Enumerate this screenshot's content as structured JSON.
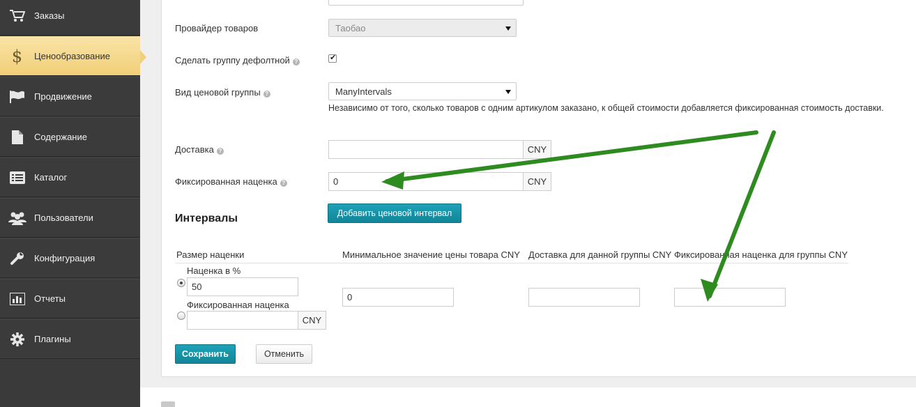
{
  "sidebar": {
    "items": [
      {
        "label": "Заказы",
        "icon": "cart-icon",
        "active": false
      },
      {
        "label": "Ценообразование",
        "icon": "dollar-icon",
        "active": true
      },
      {
        "label": "Продвижение",
        "icon": "flag-icon",
        "active": false
      },
      {
        "label": "Содержание",
        "icon": "document-icon",
        "active": false
      },
      {
        "label": "Каталог",
        "icon": "list-icon",
        "active": false
      },
      {
        "label": "Пользователи",
        "icon": "users-icon",
        "active": false
      },
      {
        "label": "Конфигурация",
        "icon": "wrench-icon",
        "active": false
      },
      {
        "label": "Отчеты",
        "icon": "chart-icon",
        "active": false
      },
      {
        "label": "Плагины",
        "icon": "gear-icon",
        "active": false
      }
    ]
  },
  "form": {
    "provider": {
      "label": "Провайдер товаров",
      "value": "Таобао"
    },
    "default_group": {
      "label": "Сделать группу дефолтной",
      "checked": true
    },
    "price_group_type": {
      "label": "Вид ценовой группы",
      "value": "ManyIntervals"
    },
    "hint": "Независимо от того, сколько товаров с одним артикулом заказано, к общей стоимости добавляется фиксированная стоимость доставки.",
    "delivery": {
      "label": "Доставка",
      "value": "",
      "currency": "CNY"
    },
    "fixed_markup": {
      "label": "Фиксированная наценка",
      "value": "0",
      "currency": "CNY"
    },
    "add_interval_button": "Добавить ценовой интервал"
  },
  "intervals": {
    "title": "Интервалы",
    "columns": [
      "Размер наценки",
      "Минимальное значение цены товара CNY",
      "Доставка для данной группы CNY",
      "Фиксированная наценка для группы CNY"
    ],
    "row": {
      "percent_label": "Наценка в %",
      "percent_value": "50",
      "percent_selected": true,
      "fixed_label": "Фиксированная наценка",
      "fixed_value": "",
      "fixed_currency": "CNY",
      "min_price": "0",
      "group_delivery": "",
      "group_fixed_markup": ""
    }
  },
  "actions": {
    "save": "Сохранить",
    "cancel": "Отменить"
  },
  "colors": {
    "sidebar_bg": "#3b3b3b",
    "active_item": "#f1cf78",
    "primary_button": "#1a93a8",
    "annotation_arrow": "#2e8b1f"
  }
}
